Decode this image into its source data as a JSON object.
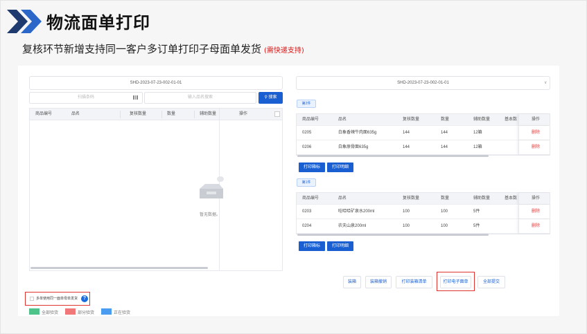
{
  "slide": {
    "title": "物流面单打印",
    "subtitle": "复核环节新增支持同一客户多订单打印子母面单发货",
    "subtitle_note": "(需快递支持)"
  },
  "left_panel": {
    "order_select": "SHD-2023-07-23-002-01-01",
    "scan_placeholder": "扫描条码",
    "goods_placeholder": "输入品名搜索",
    "search_label": "搜索",
    "columns": [
      "商品编号",
      "品名",
      "复核数量",
      "数量",
      "辅助数量",
      "操作"
    ],
    "empty_text": "暂无数据。"
  },
  "right_panel": {
    "order_select": "SHD-2023-07-23-002-01-01",
    "packages": [
      {
        "tag": "第2件",
        "columns": [
          "商品编号",
          "品名",
          "复核数量",
          "数量",
          "辅助数量",
          "基本数",
          "操作"
        ],
        "rows": [
          {
            "code": "0205",
            "name": "白象香辣牛肉面635g",
            "checked": "144",
            "qty": "144",
            "aux": "12箱",
            "action": "删除"
          },
          {
            "code": "0206",
            "name": "白象原骨面635g",
            "checked": "144",
            "qty": "144",
            "aux": "12箱",
            "action": "删除"
          }
        ],
        "print_label": "打印箱标",
        "print_detail": "打印明细"
      },
      {
        "tag": "第1件",
        "columns": [
          "商品编号",
          "品名",
          "复核数量",
          "数量",
          "辅助数量",
          "基本数",
          "操作"
        ],
        "rows": [
          {
            "code": "0203",
            "name": "哇哈哈矿泉水200ml",
            "checked": "100",
            "qty": "100",
            "aux": "5件",
            "action": "删除"
          },
          {
            "code": "0204",
            "name": "农夫山泉200ml",
            "checked": "100",
            "qty": "100",
            "aux": "5件",
            "action": "删除"
          }
        ],
        "print_label": "打印箱标",
        "print_detail": "打印明细"
      }
    ]
  },
  "actions": [
    "装箱",
    "装箱撤销",
    "打印装箱清单",
    "打印电子面单",
    "全部提交"
  ],
  "multi_order_label": "多单使用同一面单母单发货",
  "legend": [
    {
      "label": "全部验货",
      "color": "#4fc48a"
    },
    {
      "label": "部分验货",
      "color": "#f07878"
    },
    {
      "label": "正在验货",
      "color": "#4a9cf0"
    }
  ],
  "colors": {
    "primary": "#1a5fd1",
    "highlight": "#e0332e",
    "danger": "#e23b3b"
  }
}
